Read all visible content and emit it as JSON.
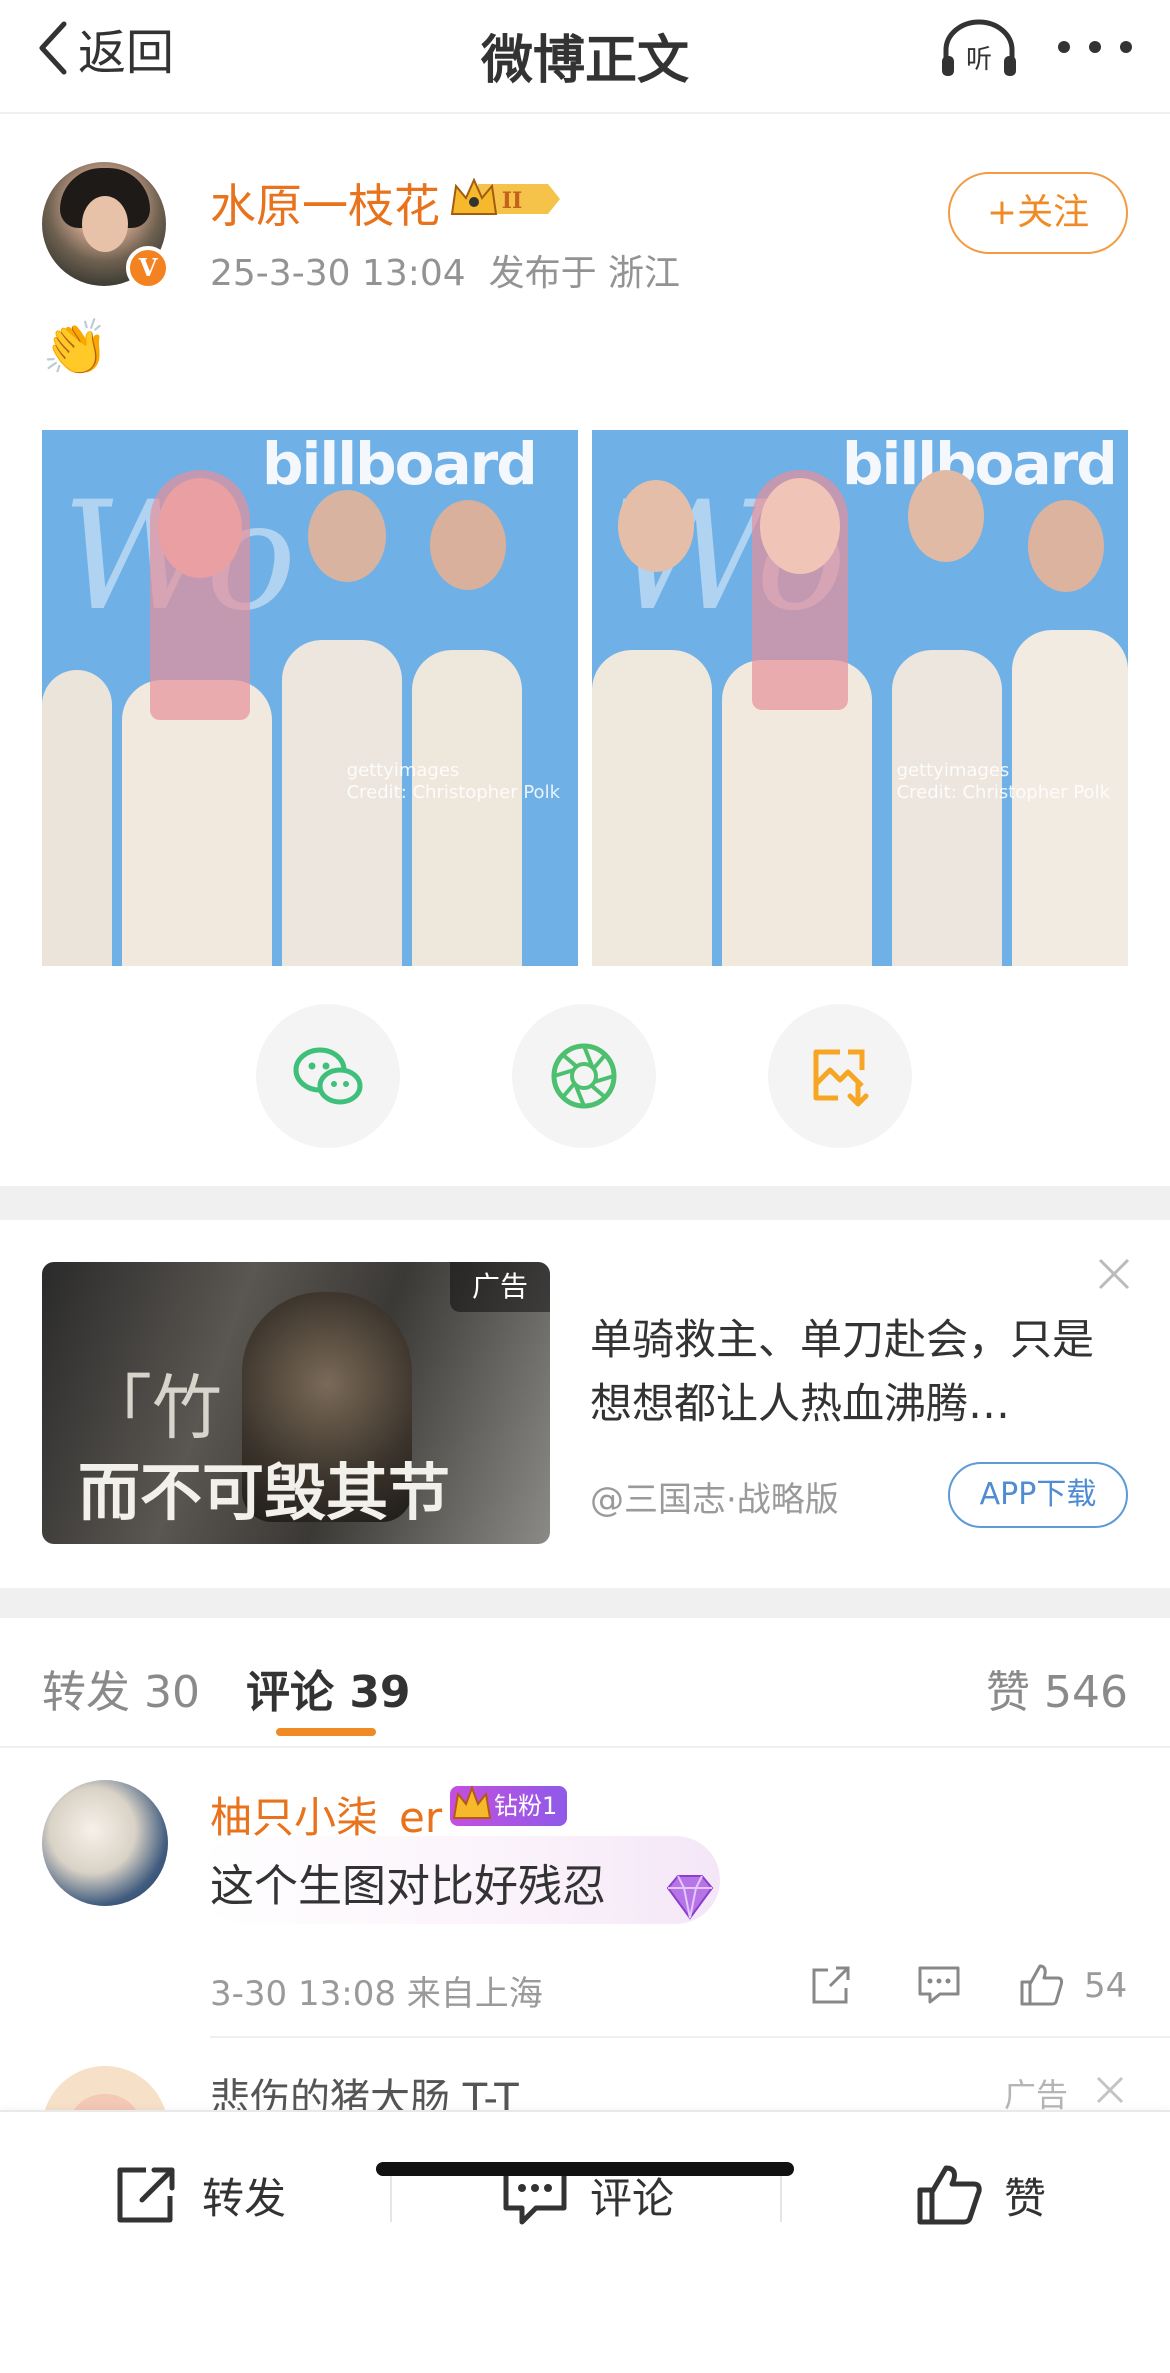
{
  "nav": {
    "back_label": "返回",
    "title": "微博正文",
    "listen_label": "听"
  },
  "post": {
    "username": "水原一枝花",
    "level_badge": "II",
    "time": "25-3-30 13:04",
    "location": "发布于 浙江",
    "follow_label": "+关注",
    "content": "👏",
    "photo_watermark_brand": "billboard",
    "photo_credit": [
      "gettyimages",
      "Credit: Christopher Polk"
    ],
    "verified_mark": "V"
  },
  "share": {
    "items": [
      "wechat-icon",
      "moments-icon",
      "save-image-icon"
    ]
  },
  "ad": {
    "tag": "广告",
    "image_text": [
      "「竹",
      "而不可毁其节"
    ],
    "text": "单骑救主、单刀赴会，只是想想都让人热血沸腾…",
    "source": "@三国志·战略版",
    "download_label": "APP下载"
  },
  "tabs": {
    "repost": "转发 30",
    "comments": "评论 39",
    "likes": "赞 546"
  },
  "comments": [
    {
      "username": "柚只小柒_er",
      "badge": "钻粉1",
      "text": "这个生图对比好残忍",
      "meta": "3-30 13:08 来自上海",
      "likes": "54"
    },
    {
      "username": "悲伤的猪大肠 T-T",
      "ad_tag": "广告"
    }
  ],
  "bottombar": {
    "repost": "转发",
    "comment": "评论",
    "like": "赞"
  },
  "colors": {
    "accent_orange": "#f08a24",
    "username_orange": "#e8731c",
    "link_blue": "#4f8cd2",
    "wechat_green": "#3fc07a",
    "save_orange": "#f6a623"
  }
}
